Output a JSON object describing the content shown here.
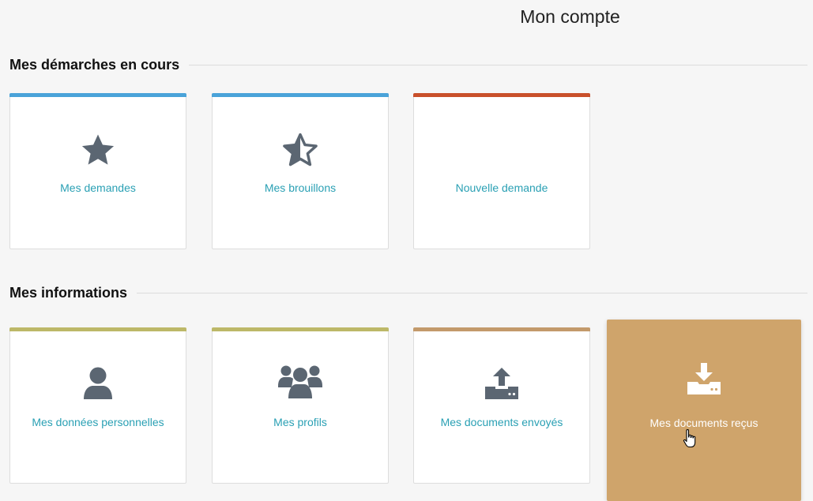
{
  "header": {
    "title": "Mon compte"
  },
  "colors": {
    "blue": "#4aa3d9",
    "red": "#c9502b",
    "olive": "#bdb868",
    "tan": "#c39a6b",
    "active_bg": "#cfa46b",
    "link": "#2aa0b4",
    "icon": "#5b6672"
  },
  "sections": {
    "current": {
      "title": "Mes démarches en cours",
      "cards": [
        {
          "label": "Mes demandes",
          "icon": "star-icon"
        },
        {
          "label": "Mes brouillons",
          "icon": "star-half-icon"
        },
        {
          "label": "Nouvelle demande",
          "icon": "none"
        }
      ]
    },
    "info": {
      "title": "Mes informations",
      "cards": [
        {
          "label": "Mes données personnelles",
          "icon": "user-icon"
        },
        {
          "label": "Mes profils",
          "icon": "users-icon"
        },
        {
          "label": "Mes documents envoyés",
          "icon": "upload-icon"
        },
        {
          "label": "Mes documents reçus",
          "icon": "download-icon"
        }
      ]
    }
  }
}
